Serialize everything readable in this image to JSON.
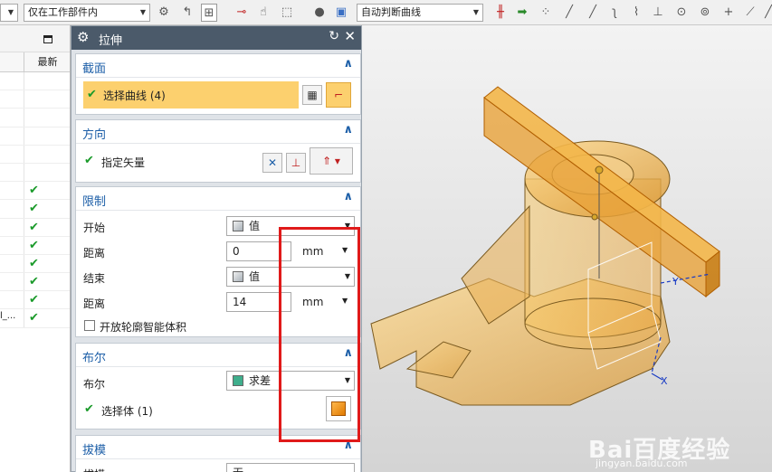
{
  "toolbar": {
    "filter_combo": "",
    "scope_combo": "仅在工作部件内",
    "curve_rule_combo": "自动判断曲线"
  },
  "navigator": {
    "col_latest": "最新",
    "truncated_text": "l_...",
    "check_rows": 8
  },
  "dialog": {
    "title": "拉伸",
    "section_group": {
      "title": "截面",
      "select_curve_label": "选择曲线 (4)"
    },
    "direction_group": {
      "title": "方向",
      "vector_label": "指定矢量"
    },
    "limits_group": {
      "title": "限制",
      "start_label": "开始",
      "start_value": "值",
      "start_distance_label": "距离",
      "start_distance_value": "0",
      "start_unit": "mm",
      "end_label": "结束",
      "end_value": "值",
      "end_distance_label": "距离",
      "end_distance_value": "14",
      "end_unit": "mm",
      "open_profile_label": "开放轮廓智能体积"
    },
    "boolean_group": {
      "title": "布尔",
      "boolean_label": "布尔",
      "boolean_value": "求差",
      "select_body_label": "选择体 (1)"
    },
    "draft_group": {
      "title": "拔模",
      "draft_label": "拔模",
      "draft_value": "无"
    }
  },
  "viewport": {
    "axis_y": "Y",
    "axis_x": "X",
    "watermark": "Bai百度经验",
    "watermark_url": "jingyan.baidu.com"
  },
  "colors": {
    "dialog_title_bg": "#4b5a6a",
    "group_title": "#1d5fa8",
    "selection_highlight": "#fcd06e",
    "check_green": "#1a9a2a",
    "annotation_red": "#e01a1a",
    "part_orange": "#e8a23a"
  }
}
